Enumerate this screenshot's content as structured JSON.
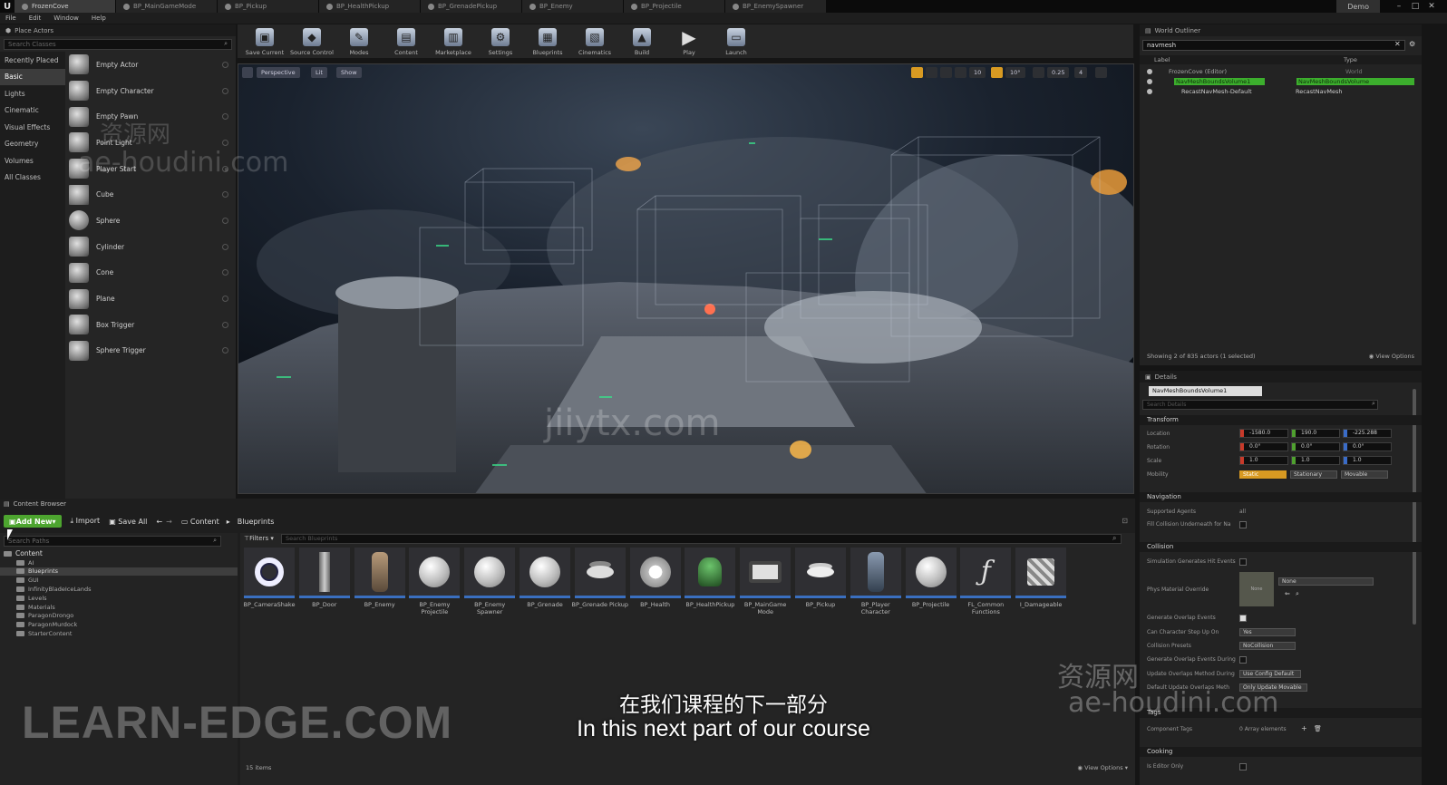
{
  "window": {
    "tabs": [
      "FrozenCove",
      "BP_MainGameMode",
      "BP_Pickup",
      "BP_HealthPickup",
      "BP_GrenadePickup",
      "BP_Enemy",
      "BP_Projectile",
      "BP_EnemySpawner"
    ],
    "demo_label": "Demo",
    "controls": {
      "minimize": "–",
      "maximize": "□",
      "close": "✕"
    }
  },
  "menu": [
    "File",
    "Edit",
    "Window",
    "Help"
  ],
  "place_actors": {
    "title": "Place Actors",
    "search_placeholder": "Search Classes",
    "categories": [
      "Recently Placed",
      "Basic",
      "Lights",
      "Cinematic",
      "Visual Effects",
      "Geometry",
      "Volumes",
      "All Classes"
    ],
    "selected_category": "Basic",
    "items": [
      "Empty Actor",
      "Empty Character",
      "Empty Pawn",
      "Point Light",
      "Player Start",
      "Cube",
      "Sphere",
      "Cylinder",
      "Cone",
      "Plane",
      "Box Trigger",
      "Sphere Trigger"
    ]
  },
  "toolbar": {
    "buttons": [
      "Save Current",
      "Source Control",
      "Modes",
      "Content",
      "Marketplace",
      "Settings",
      "Blueprints",
      "Cinematics",
      "Build",
      "Play",
      "Launch"
    ]
  },
  "viewport": {
    "perspective": "Perspective",
    "lit": "Lit",
    "show": "Show",
    "grid_snap": "10",
    "rot_snap": "10°",
    "scale_snap": "0.25",
    "cam_speed": "4"
  },
  "outliner": {
    "title": "World Outliner",
    "search_value": "navmesh",
    "col_label": "Label",
    "col_type": "Type",
    "rows": [
      {
        "label": "FrozenCove (Editor)",
        "type": "World"
      },
      {
        "label": "NavMeshBoundsVolume1",
        "type": "NavMeshBoundsVolume"
      },
      {
        "label": "RecastNavMesh-Default",
        "type": "RecastNavMesh"
      }
    ],
    "status": "Showing 2 of 835 actors (1 selected)",
    "view_options": "View Options"
  },
  "details": {
    "title": "Details",
    "name_value": "NavMeshBoundsVolume1",
    "search_placeholder": "Search Details",
    "transform": {
      "section": "Transform",
      "location_label": "Location",
      "location": [
        "-1580.0",
        "190.0",
        "-225.288"
      ],
      "rotation_label": "Rotation",
      "rotation": [
        "0.0°",
        "0.0°",
        "0.0°"
      ],
      "scale_label": "Scale",
      "scale": [
        "1.0",
        "1.0",
        "1.0"
      ],
      "mobility_label": "Mobility",
      "mobility": [
        "Static",
        "Stationary",
        "Movable"
      ]
    },
    "navigation": {
      "section": "Navigation",
      "supported_agents": "Supported Agents",
      "supported_agents_value": "all",
      "fill_collision": "Fill Collision Underneath for Na"
    },
    "collision": {
      "section": "Collision",
      "sim_gen_hit": "Simulation Generates Hit Events",
      "phys_mat": "Phys Material Override",
      "phys_mat_value": "None",
      "phys_thumb": "None",
      "gen_overlap": "Generate Overlap Events",
      "can_step": "Can Character Step Up On",
      "can_step_value": "Yes",
      "presets": "Collision Presets",
      "presets_value": "NoCollision",
      "gen_overlap_during": "Generate Overlap Events During",
      "update_overlap": "Update Overlaps Method During",
      "update_overlap_value": "Use Config Default",
      "default_update": "Default Update Overlaps Meth",
      "default_update_value": "Only Update Movable"
    },
    "tags": {
      "section": "Tags",
      "component_tags": "Component Tags",
      "component_tags_value": "0 Array elements"
    },
    "cooking": {
      "section": "Cooking",
      "is_editor_only": "Is Editor Only"
    }
  },
  "content_browser": {
    "title": "Content Browser",
    "add_new": "Add New",
    "import": "Import",
    "save_all": "Save All",
    "breadcrumb": [
      "Content",
      "Blueprints"
    ],
    "search_paths_placeholder": "Search Paths",
    "filters": "Filters",
    "search_assets_placeholder": "Search Blueprints",
    "tree": [
      "Content",
      "AI",
      "Blueprints",
      "GUI",
      "InfinityBladeIceLands",
      "Levels",
      "Materials",
      "ParagonDrongo",
      "ParagonMurdock",
      "StarterContent"
    ],
    "assets": [
      "BP_CameraShake",
      "BP_Door",
      "BP_Enemy",
      "BP_Enemy Projectile",
      "BP_Enemy Spawner",
      "BP_Grenade",
      "BP_Grenade Pickup",
      "BP_Health",
      "BP_HealthPickup",
      "BP_MainGame Mode",
      "BP_Pickup",
      "BP_Player Character",
      "BP_Projectile",
      "FL_Common Functions",
      "I_Damageable"
    ],
    "item_count": "15 items",
    "view_options": "View Options"
  },
  "overlays": {
    "subtitle_cn": "在我们课程的下一部分",
    "subtitle_en": "In this next part of our course",
    "watermark_learn": "LEARN-EDGE.COM",
    "watermark_cn1": "资源网",
    "watermark_host1": "ae-houdini.com",
    "watermark_site": "jiiytx.com",
    "watermark_cn2": "资源网",
    "watermark_host2": "ae-houdini.com"
  },
  "colors": {
    "accent_green": "#4da52f",
    "selection_orange": "#e8a11a",
    "asset_underline": "#3a6fc0"
  }
}
